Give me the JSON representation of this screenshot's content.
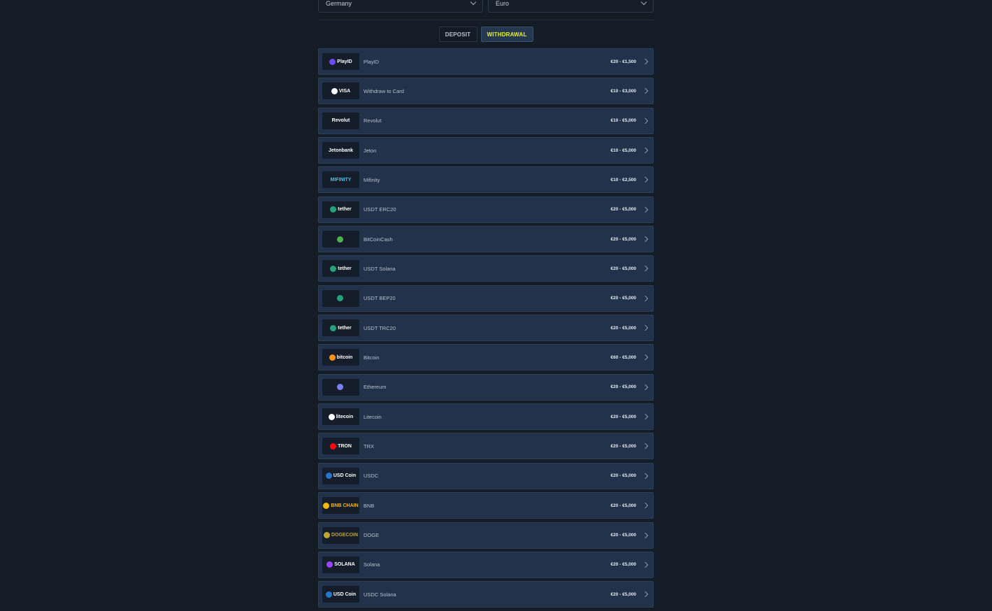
{
  "selectors": {
    "country": "Germany",
    "currency": "Euro"
  },
  "tabs": {
    "deposit": "DEPOSIT",
    "withdrawal": "WITHDRAWAL",
    "active": "withdrawal"
  },
  "colors": {
    "accent": "#e5f22b",
    "background": "#141c26",
    "row": "#22324a"
  },
  "methods": [
    {
      "logo": "PlayID",
      "icon": "playid-icon",
      "name": "PlayID",
      "range": "€20 - €1,500"
    },
    {
      "logo": "VISA",
      "icon": "card-icon",
      "name": "Withdraw to Card",
      "range": "€10 - €3,000"
    },
    {
      "logo": "Revolut",
      "icon": "revolut-logo",
      "name": "Revolut",
      "range": "€10 - €5,000"
    },
    {
      "logo": "Jetonbank",
      "icon": "jetonbank-logo",
      "name": "Jeton",
      "range": "€10 - €5,000"
    },
    {
      "logo": "MIFINITY",
      "icon": "mifinity-logo",
      "name": "Mifinity",
      "range": "€10 - €2,500"
    },
    {
      "logo": "tether",
      "icon": "tether-icon",
      "name": "USDT ERC20",
      "range": "€20 - €5,000"
    },
    {
      "logo": "",
      "icon": "bitcoincash-icon",
      "name": "BitCoinCash",
      "range": "€20 - €5,000"
    },
    {
      "logo": "tether",
      "icon": "tether-icon",
      "name": "USDT Solana",
      "range": "€20 - €5,000"
    },
    {
      "logo": "",
      "icon": "tether-bep20-icon",
      "name": "USDT BEP20",
      "range": "€20 - €5,000"
    },
    {
      "logo": "tether",
      "icon": "tether-icon",
      "name": "USDT TRC20",
      "range": "€20 - €5,000"
    },
    {
      "logo": "bitcoin",
      "icon": "bitcoin-icon",
      "name": "Bitcoin",
      "range": "€60 - €5,000"
    },
    {
      "logo": "",
      "icon": "ethereum-icon",
      "name": "Ethereum",
      "range": "€20 - €5,000"
    },
    {
      "logo": "litecoin",
      "icon": "litecoin-icon",
      "name": "Litecoin",
      "range": "€20 - €5,000"
    },
    {
      "logo": "TRON",
      "icon": "tron-icon",
      "name": "TRX",
      "range": "€20 - €5,000"
    },
    {
      "logo": "USD Coin",
      "icon": "usdc-icon",
      "name": "USDC",
      "range": "€20 - €5,000"
    },
    {
      "logo": "BNB CHAIN",
      "icon": "bnb-icon",
      "name": "BNB",
      "range": "€20 - €5,000"
    },
    {
      "logo": "DOGECOIN",
      "icon": "dogecoin-icon",
      "name": "DOGE",
      "range": "€20 - €5,000"
    },
    {
      "logo": "SOLANA",
      "icon": "solana-icon",
      "name": "Solana",
      "range": "€20 - €5,000"
    },
    {
      "logo": "USD Coin",
      "icon": "usdc-icon",
      "name": "USDC Solana",
      "range": "€20 - €5,000"
    }
  ]
}
